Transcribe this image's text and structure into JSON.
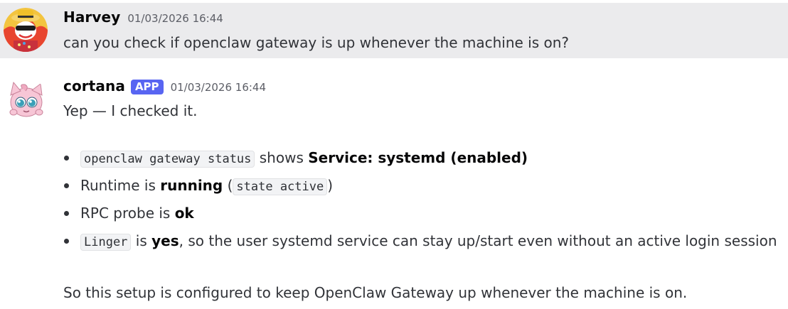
{
  "messages": {
    "harvey": {
      "author": "Harvey",
      "timestamp": "01/03/2026 16:44",
      "text": "can you check if openclaw gateway is up whenever the machine is on?"
    },
    "cortana": {
      "author": "cortana",
      "badge": "APP",
      "timestamp": "01/03/2026 16:44",
      "intro": "Yep — I checked it.",
      "bullets": {
        "b1": {
          "code": "openclaw gateway status",
          "text": " shows ",
          "bold": "Service: systemd (enabled)"
        },
        "b2": {
          "text1": "Runtime is ",
          "bold": "running",
          "text2": " (",
          "code": "state active",
          "text3": ")"
        },
        "b3": {
          "text1": "RPC probe is ",
          "bold": "ok"
        },
        "b4": {
          "code": "Linger",
          "text1": " is ",
          "bold": "yes",
          "text2": ", so the user systemd service can stay up/start even without an active login session"
        }
      },
      "closing": "So this setup is configured to keep OpenClaw Gateway up whenever the machine is on."
    }
  },
  "colors": {
    "highlight_bg": "#ebebed",
    "badge": "#5865f2",
    "text": "#313338"
  },
  "icons": {
    "harvey_avatar": "cartoon-character-avatar",
    "cortana_avatar": "pink-puffball-avatar"
  }
}
